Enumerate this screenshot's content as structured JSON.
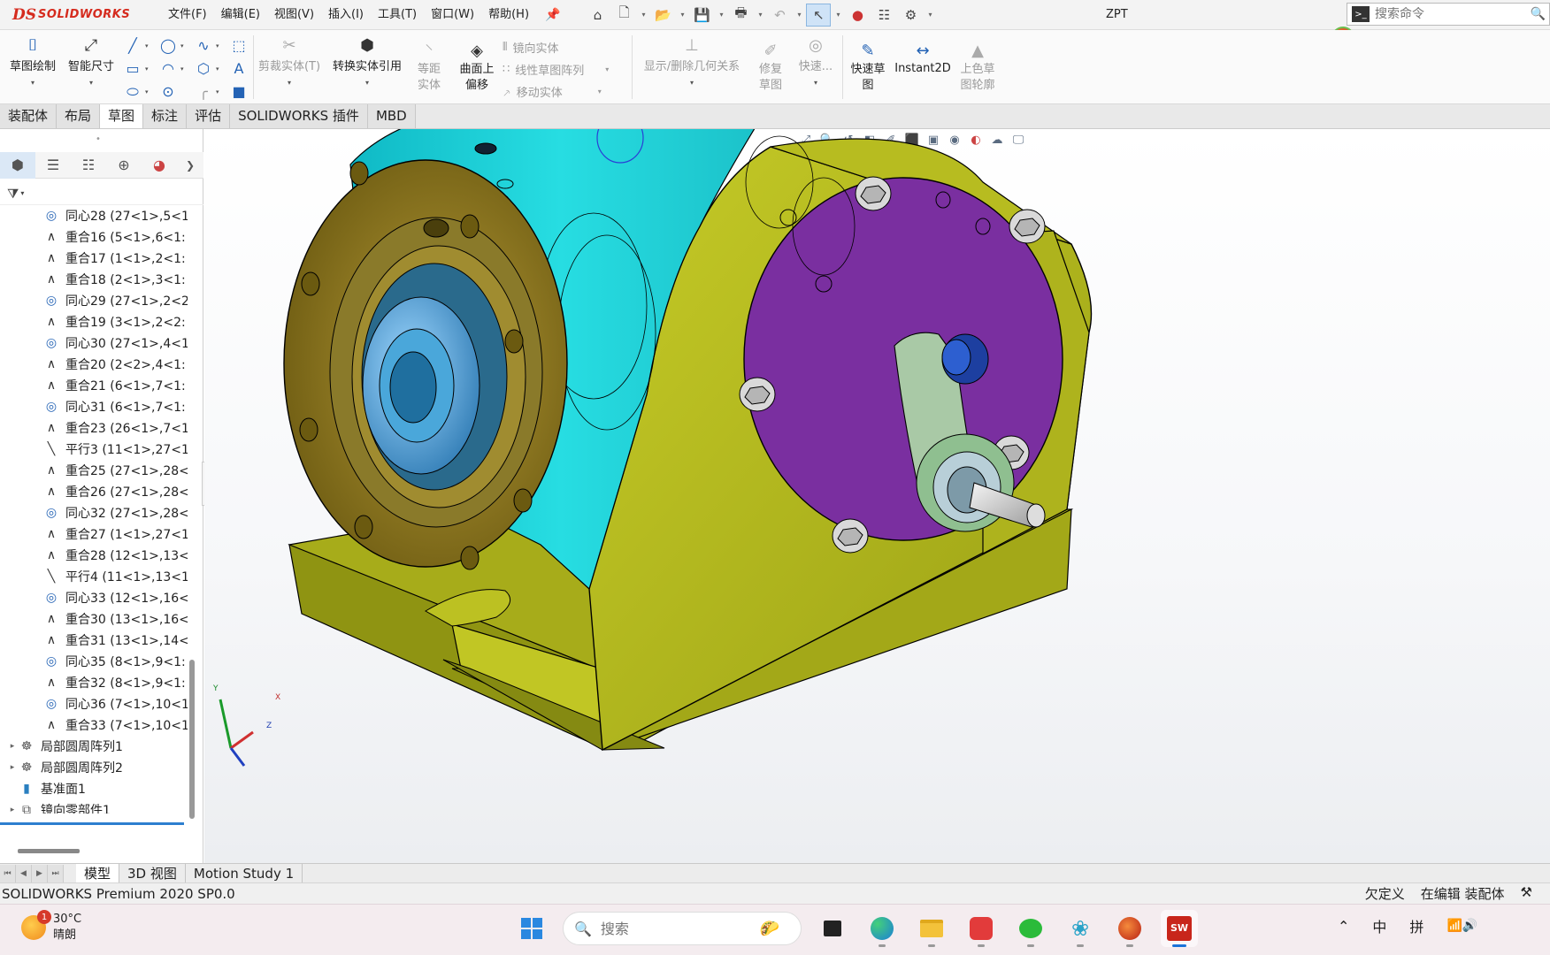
{
  "app": {
    "logo_ds": "DS",
    "logo_text": "SOLIDWORKS",
    "doc_title": "ZPT"
  },
  "menu": [
    "文件(F)",
    "编辑(E)",
    "视图(V)",
    "插入(I)",
    "工具(T)",
    "窗口(W)",
    "帮助(H)"
  ],
  "command_search": {
    "placeholder": "搜索命令"
  },
  "ribbon": {
    "sketch": "草图绘制",
    "smart_dim": "智能尺寸",
    "trim": "剪裁实体(T)",
    "convert": "转换实体引用",
    "offset": "等距实体",
    "surface_offset": "曲面上偏移",
    "mirror": "镜向实体",
    "linear_pattern": "线性草图阵列",
    "move": "移动实体",
    "display_relations": "显示/删除几何关系",
    "repair": "修复草图",
    "quick_snaps": "快速...",
    "rapid_sketch": "快速草图",
    "instant2d": "Instant2D",
    "shaded_contours": "上色草图轮廓"
  },
  "tabs": [
    "装配体",
    "布局",
    "草图",
    "标注",
    "评估",
    "SOLIDWORKS 插件",
    "MBD"
  ],
  "active_tab": "草图",
  "tree_items": [
    {
      "type": "concentric",
      "label": "同心28 (27<1>,5<1"
    },
    {
      "type": "coincident",
      "label": "重合16 (5<1>,6<1:"
    },
    {
      "type": "coincident",
      "label": "重合17 (1<1>,2<1:"
    },
    {
      "type": "coincident",
      "label": "重合18 (2<1>,3<1:"
    },
    {
      "type": "concentric",
      "label": "同心29 (27<1>,2<2"
    },
    {
      "type": "coincident",
      "label": "重合19 (3<1>,2<2:"
    },
    {
      "type": "concentric",
      "label": "同心30 (27<1>,4<1"
    },
    {
      "type": "coincident",
      "label": "重合20 (2<2>,4<1:"
    },
    {
      "type": "coincident",
      "label": "重合21 (6<1>,7<1:"
    },
    {
      "type": "concentric",
      "label": "同心31 (6<1>,7<1:"
    },
    {
      "type": "coincident",
      "label": "重合23 (26<1>,7<1"
    },
    {
      "type": "parallel",
      "label": "平行3 (11<1>,27<1"
    },
    {
      "type": "coincident",
      "label": "重合25 (27<1>,28<"
    },
    {
      "type": "coincident",
      "label": "重合26 (27<1>,28<"
    },
    {
      "type": "concentric",
      "label": "同心32 (27<1>,28<"
    },
    {
      "type": "coincident",
      "label": "重合27 (1<1>,27<1"
    },
    {
      "type": "coincident",
      "label": "重合28 (12<1>,13<"
    },
    {
      "type": "parallel",
      "label": "平行4 (11<1>,13<1"
    },
    {
      "type": "concentric",
      "label": "同心33 (12<1>,16<"
    },
    {
      "type": "coincident",
      "label": "重合30 (13<1>,16<"
    },
    {
      "type": "coincident",
      "label": "重合31 (13<1>,14<"
    },
    {
      "type": "concentric",
      "label": "同心35 (8<1>,9<1:"
    },
    {
      "type": "coincident",
      "label": "重合32 (8<1>,9<1:"
    },
    {
      "type": "concentric",
      "label": "同心36 (7<1>,10<1"
    },
    {
      "type": "coincident",
      "label": "重合33 (7<1>,10<1"
    }
  ],
  "tree_features": [
    {
      "icon": "circular-pattern-icon",
      "label": "局部圆周阵列1",
      "expand": true
    },
    {
      "icon": "circular-pattern-icon",
      "label": "局部圆周阵列2",
      "expand": true
    },
    {
      "icon": "plane-icon",
      "label": "基准面1",
      "expand": false
    },
    {
      "icon": "mirror-component-icon",
      "label": "镜向零部件1",
      "expand": true
    }
  ],
  "bottom_tabs": [
    "模型",
    "3D 视图",
    "Motion Study 1"
  ],
  "status": {
    "left": "SOLIDWORKS Premium 2020 SP0.0",
    "underdefined": "欠定义",
    "editing": "在编辑 装配体"
  },
  "triad": {
    "x": "X",
    "y": "Y",
    "z": "Z"
  },
  "taskbar": {
    "temp": "30°C",
    "condition": "晴朗",
    "weather_badge": "1",
    "search_placeholder": "搜索",
    "ime1": "中",
    "ime2": "拼"
  },
  "colors": {
    "base": "#b8bd1f",
    "base_dark": "#8d9214",
    "housing": "#1fd3da",
    "flange": "#8b7a1c",
    "plate": "#7a2fa0",
    "accent_blue": "#2463b5"
  }
}
